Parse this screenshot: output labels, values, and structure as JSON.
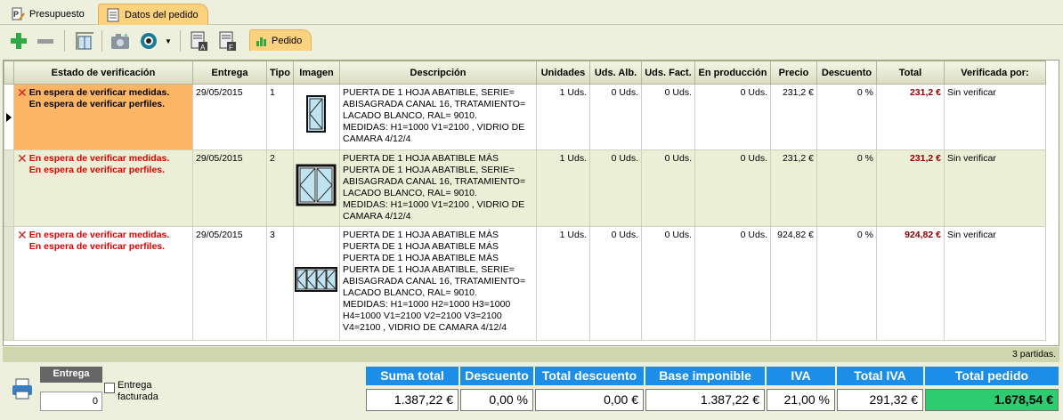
{
  "tabs": [
    {
      "label": "Presupuesto",
      "icon": "document-edit-icon"
    },
    {
      "label": "Datos del pedido",
      "icon": "list-document-icon"
    }
  ],
  "toolbar": {
    "subtab_label": "Pedido",
    "buttons": [
      "add-icon",
      "remove-icon",
      "measure-icon",
      "camera-icon",
      "view-icon",
      "document-a-icon",
      "document-f-icon"
    ]
  },
  "columns": [
    "Estado de verificación",
    "Entrega",
    "Tipo",
    "Imagen",
    "Descripción",
    "Unidades",
    "Uds. Alb.",
    "Uds. Fact.",
    "En producción",
    "Precio",
    "Descuento",
    "Total",
    "Verificada por:"
  ],
  "rows": [
    {
      "status1": "En espera de verificar medidas.",
      "status2": "En espera de verificar perfiles.",
      "entrega": "29/05/2015",
      "tipo": "1",
      "descripcion": "PUERTA DE 1 HOJA ABATIBLE, SERIE= ABISAGRADA CANAL 16,  TRATAMIENTO= LACADO BLANCO, RAL= 9010.\nMEDIDAS: H1=1000 V1=2100  , VIDRIO DE CAMARA 4/12/4",
      "unidades": "1 Uds.",
      "alb": "0 Uds.",
      "fact": "0 Uds.",
      "prod": "0 Uds.",
      "precio": "231,2 €",
      "descuento": "0 %",
      "total": "231,2 €",
      "verificada": "Sin verificar"
    },
    {
      "status1": "En espera de verificar medidas.",
      "status2": "En espera de verificar perfiles.",
      "entrega": "29/05/2015",
      "tipo": "2",
      "descripcion": "PUERTA DE 1 HOJA ABATIBLE MÁS PUERTA DE 1 HOJA ABATIBLE, SERIE= ABISAGRADA CANAL 16,  TRATAMIENTO=  LACADO BLANCO, RAL= 9010.\nMEDIDAS: H1=1000 V1=2100  , VIDRIO DE CAMARA 4/12/4",
      "unidades": "1 Uds.",
      "alb": "0 Uds.",
      "fact": "0 Uds.",
      "prod": "0 Uds.",
      "precio": "231,2 €",
      "descuento": "0 %",
      "total": "231,2 €",
      "verificada": "Sin verificar"
    },
    {
      "status1": "En espera de verificar medidas.",
      "status2": "En espera de verificar perfiles.",
      "entrega": "29/05/2015",
      "tipo": "3",
      "descripcion": "PUERTA DE 1 HOJA ABATIBLE MÁS PUERTA DE 1 HOJA ABATIBLE MÁS PUERTA DE 1 HOJA ABATIBLE MÁS PUERTA DE 1 HOJA ABATIBLE, SERIE= ABISAGRADA CANAL 16,  TRATAMIENTO=  LACADO BLANCO, RAL= 9010.\nMEDIDAS: H1=1000 H2=1000 H3=1000 H4=1000 V1=2100 V2=2100 V3=2100 V4=2100  , VIDRIO DE CAMARA 4/12/4",
      "unidades": "1 Uds.",
      "alb": "0 Uds.",
      "fact": "0 Uds.",
      "prod": "0 Uds.",
      "precio": "924,82 €",
      "descuento": "0 %",
      "total": "924,82 €",
      "verificada": "Sin verificar"
    }
  ],
  "partidas": "3 partidas.",
  "entrega": {
    "header": "Entrega",
    "value": "0",
    "checkbox_label": "Entrega facturada"
  },
  "summary": {
    "suma_total_h": "Suma total",
    "suma_total": "1.387,22 €",
    "descuento_h": "Descuento",
    "descuento": "0,00 %",
    "total_descuento_h": "Total descuento",
    "total_descuento": "0,00 €",
    "base_h": "Base imponible",
    "base": "1.387,22 €",
    "iva_h": "IVA",
    "iva": "21,00 %",
    "total_iva_h": "Total IVA",
    "total_iva": "291,32 €",
    "total_pedido_h": "Total pedido",
    "total_pedido": "1.678,54 €"
  },
  "colors": {
    "accent_tab": "#fcd27f",
    "selected_status": "#fcb565",
    "alt_row": "#eaefd6",
    "summary_header": "#1c8ee8",
    "total_pedido": "#2ecc71",
    "error_text": "#e00000"
  }
}
